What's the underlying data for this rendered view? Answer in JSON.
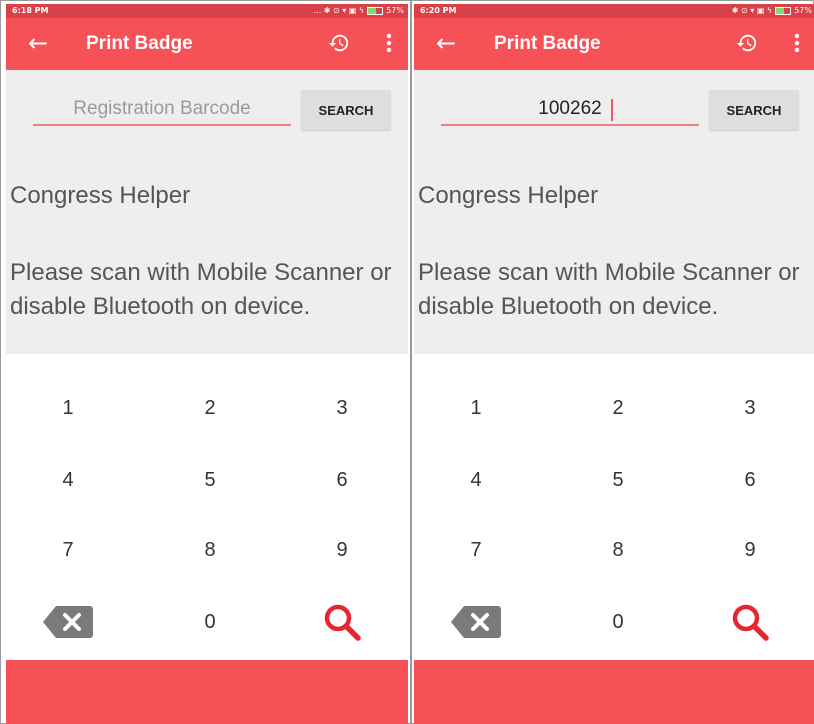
{
  "screens": [
    {
      "status_bar": {
        "time": "6:18 PM",
        "icons": "... ✱ ⊙ ▾ ▣ ϟ",
        "battery": "57%"
      },
      "app_bar": {
        "title": "Print Badge"
      },
      "search": {
        "value": "",
        "placeholder": "Registration Barcode",
        "button_label": "SEARCH"
      },
      "helper_title": "Congress Helper",
      "message": "Please scan with Mobile Scanner or disable Bluetooth on device.",
      "keypad": {
        "keys": [
          "1",
          "2",
          "3",
          "4",
          "5",
          "6",
          "7",
          "8",
          "9",
          "0"
        ]
      }
    },
    {
      "status_bar": {
        "time": "6:20 PM",
        "icons": "✱ ⊙ ▾ ▣ ϟ",
        "battery": "57%"
      },
      "app_bar": {
        "title": "Print Badge"
      },
      "search": {
        "value": "100262",
        "placeholder": "Registration Barcode",
        "button_label": "SEARCH"
      },
      "helper_title": "Congress Helper",
      "message": "Please scan with Mobile Scanner or disable Bluetooth on device.",
      "keypad": {
        "keys": [
          "1",
          "2",
          "3",
          "4",
          "5",
          "6",
          "7",
          "8",
          "9",
          "0"
        ]
      }
    }
  ],
  "colors": {
    "accent": "#f55157",
    "status_bar": "#d94148",
    "content_bg": "#eeeeee",
    "search_icon": "#e8262f",
    "backspace_icon": "#7a7a7a"
  },
  "icons": {
    "back": "arrow-left-icon",
    "history": "history-icon",
    "more": "more-vertical-icon",
    "backspace": "backspace-icon",
    "search": "search-icon"
  }
}
